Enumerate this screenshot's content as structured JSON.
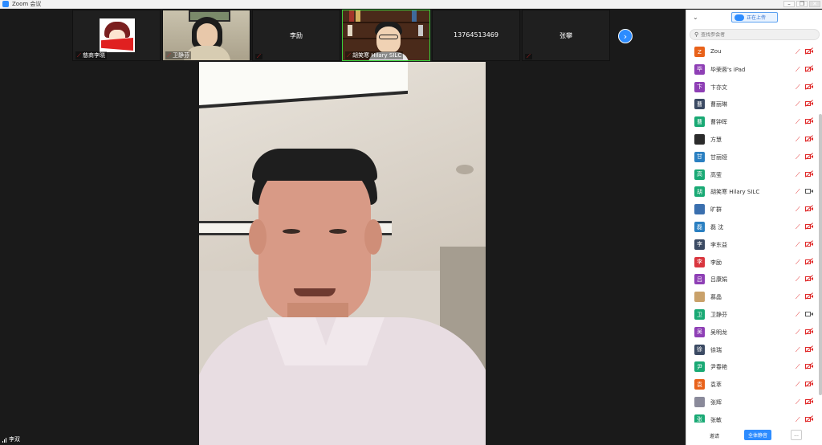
{
  "window": {
    "title": "Zoom 会议",
    "min": "–",
    "max": "□",
    "restore": "❐",
    "close": "✕"
  },
  "gallery": {
    "tiles": [
      {
        "name": "慈商李晓",
        "type": "cartoon"
      },
      {
        "name": "卫静芬",
        "type": "photo"
      },
      {
        "name": "李励",
        "type": "text"
      },
      {
        "name": "胡笑寒 Hilary SILC",
        "type": "photo"
      },
      {
        "name": "13764513469",
        "type": "text"
      },
      {
        "name": "张攀",
        "type": "text"
      }
    ],
    "next_icon": "›"
  },
  "self_view": {
    "name": "李双"
  },
  "participants_panel": {
    "upload_label": "正在上传",
    "search_placeholder": "查找参会者",
    "invite_label": "邀请",
    "mute_all_label": "全体静音",
    "more_label": "...",
    "participants": [
      {
        "name": "Zou",
        "avatar_text": "Z",
        "color": "#e8621a",
        "video": false
      },
      {
        "name": "毕荣蓉's iPad",
        "avatar_text": "毕",
        "color": "#8e3fb5",
        "video": false
      },
      {
        "name": "卞亦文",
        "avatar_text": "卞",
        "color": "#8e3fb5",
        "video": false
      },
      {
        "name": "曹丽琳",
        "avatar_text": "曹",
        "color": "#3b4a63",
        "video": false
      },
      {
        "name": "曹钟晖",
        "avatar_text": "曹",
        "color": "#19a974",
        "video": false
      },
      {
        "name": "方慧",
        "avatar_text": "",
        "color": "#2b2b2b",
        "video": false
      },
      {
        "name": "甘丽娅",
        "avatar_text": "甘",
        "color": "#2a7fc1",
        "video": false
      },
      {
        "name": "高莹",
        "avatar_text": "高",
        "color": "#19a974",
        "video": false
      },
      {
        "name": "胡笑寒 Hilary SILC",
        "avatar_text": "胡",
        "color": "#19a974",
        "video": true
      },
      {
        "name": "旷群",
        "avatar_text": "",
        "color": "#3a6fae",
        "video": false
      },
      {
        "name": "磊 沈",
        "avatar_text": "磊",
        "color": "#2a7fc1",
        "video": false
      },
      {
        "name": "李东益",
        "avatar_text": "李",
        "color": "#3b4a63",
        "video": false
      },
      {
        "name": "李励",
        "avatar_text": "李",
        "color": "#d9363e",
        "video": false
      },
      {
        "name": "吕康娟",
        "avatar_text": "吕",
        "color": "#8e3fb5",
        "video": false
      },
      {
        "name": "慕晶",
        "avatar_text": "",
        "color": "#c9a16a",
        "video": false
      },
      {
        "name": "卫静芬",
        "avatar_text": "卫",
        "color": "#19a974",
        "video": true
      },
      {
        "name": "吴明龙",
        "avatar_text": "吴",
        "color": "#8e3fb5",
        "video": false
      },
      {
        "name": "徐瑞",
        "avatar_text": "徐",
        "color": "#3b4a63",
        "video": false
      },
      {
        "name": "尹春艳",
        "avatar_text": "尹",
        "color": "#19a974",
        "video": false
      },
      {
        "name": "袁萃",
        "avatar_text": "袁",
        "color": "#e8621a",
        "video": false
      },
      {
        "name": "张辉",
        "avatar_text": "",
        "color": "#8a8a9a",
        "video": false
      },
      {
        "name": "张敏",
        "avatar_text": "张",
        "color": "#19a974",
        "video": false
      }
    ]
  }
}
